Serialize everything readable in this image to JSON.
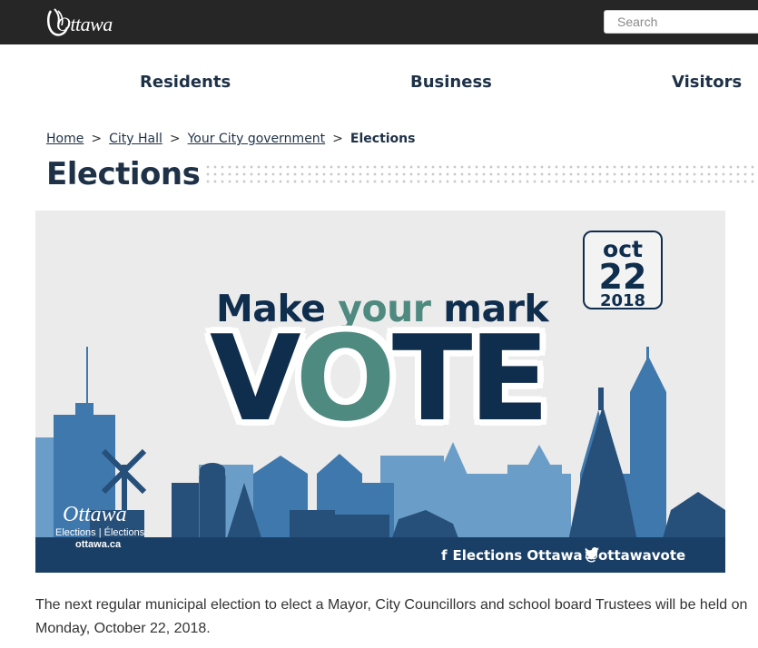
{
  "header": {
    "logo_text": "Ottawa",
    "search_placeholder": "Search"
  },
  "nav": {
    "items": [
      "Residents",
      "Business",
      "Visitors"
    ]
  },
  "breadcrumb": {
    "items": [
      "Home",
      "City Hall",
      "Your City government"
    ],
    "separator": ">",
    "current": "Elections"
  },
  "page": {
    "title": "Elections"
  },
  "banner": {
    "headline_part1": "Make ",
    "headline_part2": "your",
    "headline_part3": " mark",
    "vote_v": "V",
    "vote_o": "O",
    "vote_te": "TE",
    "date_month": "oct",
    "date_day": "22",
    "date_year": "2018",
    "logo_name": "Ottawa",
    "logo_sub": "Elections | Élections",
    "logo_url": "ottawa.ca",
    "facebook_label": "Elections Ottawa",
    "twitter_label": "@ottawavote",
    "colors": {
      "navy": "#0f2d4d",
      "teal": "#4e8a7f",
      "sky": "#ebebeb"
    }
  },
  "content": {
    "intro": "The next regular municipal election to elect a Mayor, City Councillors and school board Trustees will be held on Monday, October 22, 2018."
  }
}
